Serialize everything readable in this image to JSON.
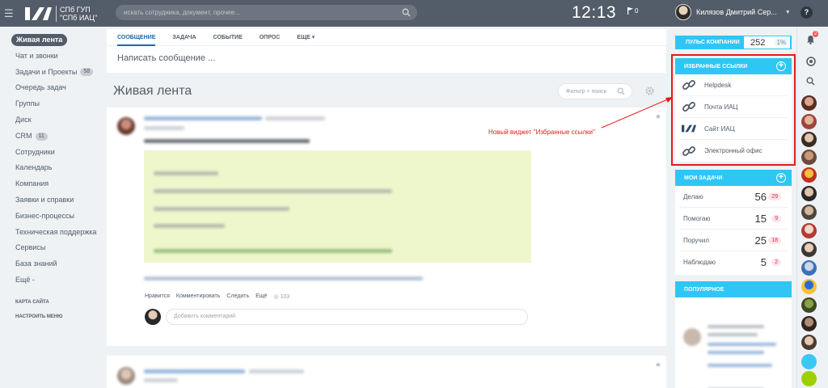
{
  "header": {
    "logo_line1": "СПб ГУП",
    "logo_line2": "\"СПб ИАЦ\"",
    "search_placeholder": "искать сотрудника, документ, прочее...",
    "clock": "12:13",
    "flag_count": "0",
    "user_name": "Килязов Дмитрий Сер...",
    "help": "?"
  },
  "leftmenu": {
    "items": [
      {
        "label": "Живая лента",
        "active": true
      },
      {
        "label": "Чат и звонки"
      },
      {
        "label": "Задачи и Проекты",
        "count": "58"
      },
      {
        "label": "Очередь задач"
      },
      {
        "label": "Группы"
      },
      {
        "label": "Диск"
      },
      {
        "label": "CRM",
        "count": "11"
      },
      {
        "label": "Сотрудники"
      },
      {
        "label": "Календарь"
      },
      {
        "label": "Компания"
      },
      {
        "label": "Заявки и справки"
      },
      {
        "label": "Бизнес-процессы"
      },
      {
        "label": "Техническая поддержка"
      },
      {
        "label": "Сервисы"
      },
      {
        "label": "База знаний"
      },
      {
        "label": "Ещё -"
      }
    ],
    "sitemap": "КАРТА САЙТА",
    "settings": "НАСТРОИТЬ МЕНЮ"
  },
  "composer": {
    "tabs": [
      "СООБЩЕНИЕ",
      "ЗАДАЧА",
      "СОБЫТИЕ",
      "ОПРОС",
      "ЕЩЕ ▾"
    ],
    "placeholder": "Написать сообщение ..."
  },
  "feed": {
    "title": "Живая лента",
    "filter_placeholder": "Фильтр + поиск",
    "post_actions": [
      "Нравится",
      "Комментировать",
      "Следить",
      "Ещё",
      "◎ 103"
    ],
    "comment_placeholder": "Добавить комментарий"
  },
  "pulse": {
    "label": "ПУЛЬС КОМПАНИИ",
    "value": "252",
    "percent": "1%"
  },
  "favorites": {
    "title": "ИЗБРАННЫЕ ССЫЛКИ",
    "links": [
      {
        "label": "Helpdesk",
        "icon": "link-icon"
      },
      {
        "label": "Почта ИАЦ",
        "icon": "link-icon"
      },
      {
        "label": "Сайт ИАЦ",
        "icon": "iac-logo-icon"
      },
      {
        "label": "Электронный офис",
        "icon": "link-icon"
      }
    ]
  },
  "annotation": "Новый виджет \"Избранные ссылки\"",
  "tasks": {
    "title": "МОИ ЗАДАЧИ",
    "rows": [
      {
        "label": "Делаю",
        "value": "56",
        "badge": "29"
      },
      {
        "label": "Помогаю",
        "value": "15",
        "badge": "9"
      },
      {
        "label": "Поручил",
        "value": "25",
        "badge": "18"
      },
      {
        "label": "Наблюдаю",
        "value": "5",
        "badge": "2"
      }
    ]
  },
  "popular": {
    "title": "ПОПУЛЯРНОЕ"
  },
  "rightbar": {
    "notif_count": "2"
  },
  "colors": {
    "topbar": "#535c69",
    "accent": "#2fc6f6",
    "highlight": "#e51a1a",
    "post_box": "#eef7cc"
  }
}
